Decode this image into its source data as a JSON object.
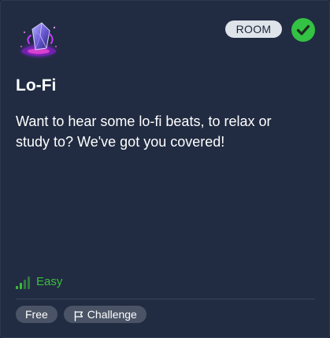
{
  "card": {
    "thumbnail_icon": "lofi-crystal-icon",
    "badge": "ROOM",
    "completed_icon": "checkmark-icon",
    "title": "Lo-Fi",
    "description": "Want to hear some lo-fi beats, to relax or study to? We've got you covered!",
    "difficulty": {
      "label": "Easy",
      "icon": "signal-bars-icon",
      "color": "#3bbf3b"
    },
    "tags": [
      {
        "label": "Free"
      },
      {
        "label": "Challenge",
        "icon": "flag-icon"
      }
    ]
  },
  "colors": {
    "background": "#212c42",
    "badge_bg": "#dfe3ea",
    "check_bg": "#33c244",
    "tag_bg": "#4a5466"
  }
}
